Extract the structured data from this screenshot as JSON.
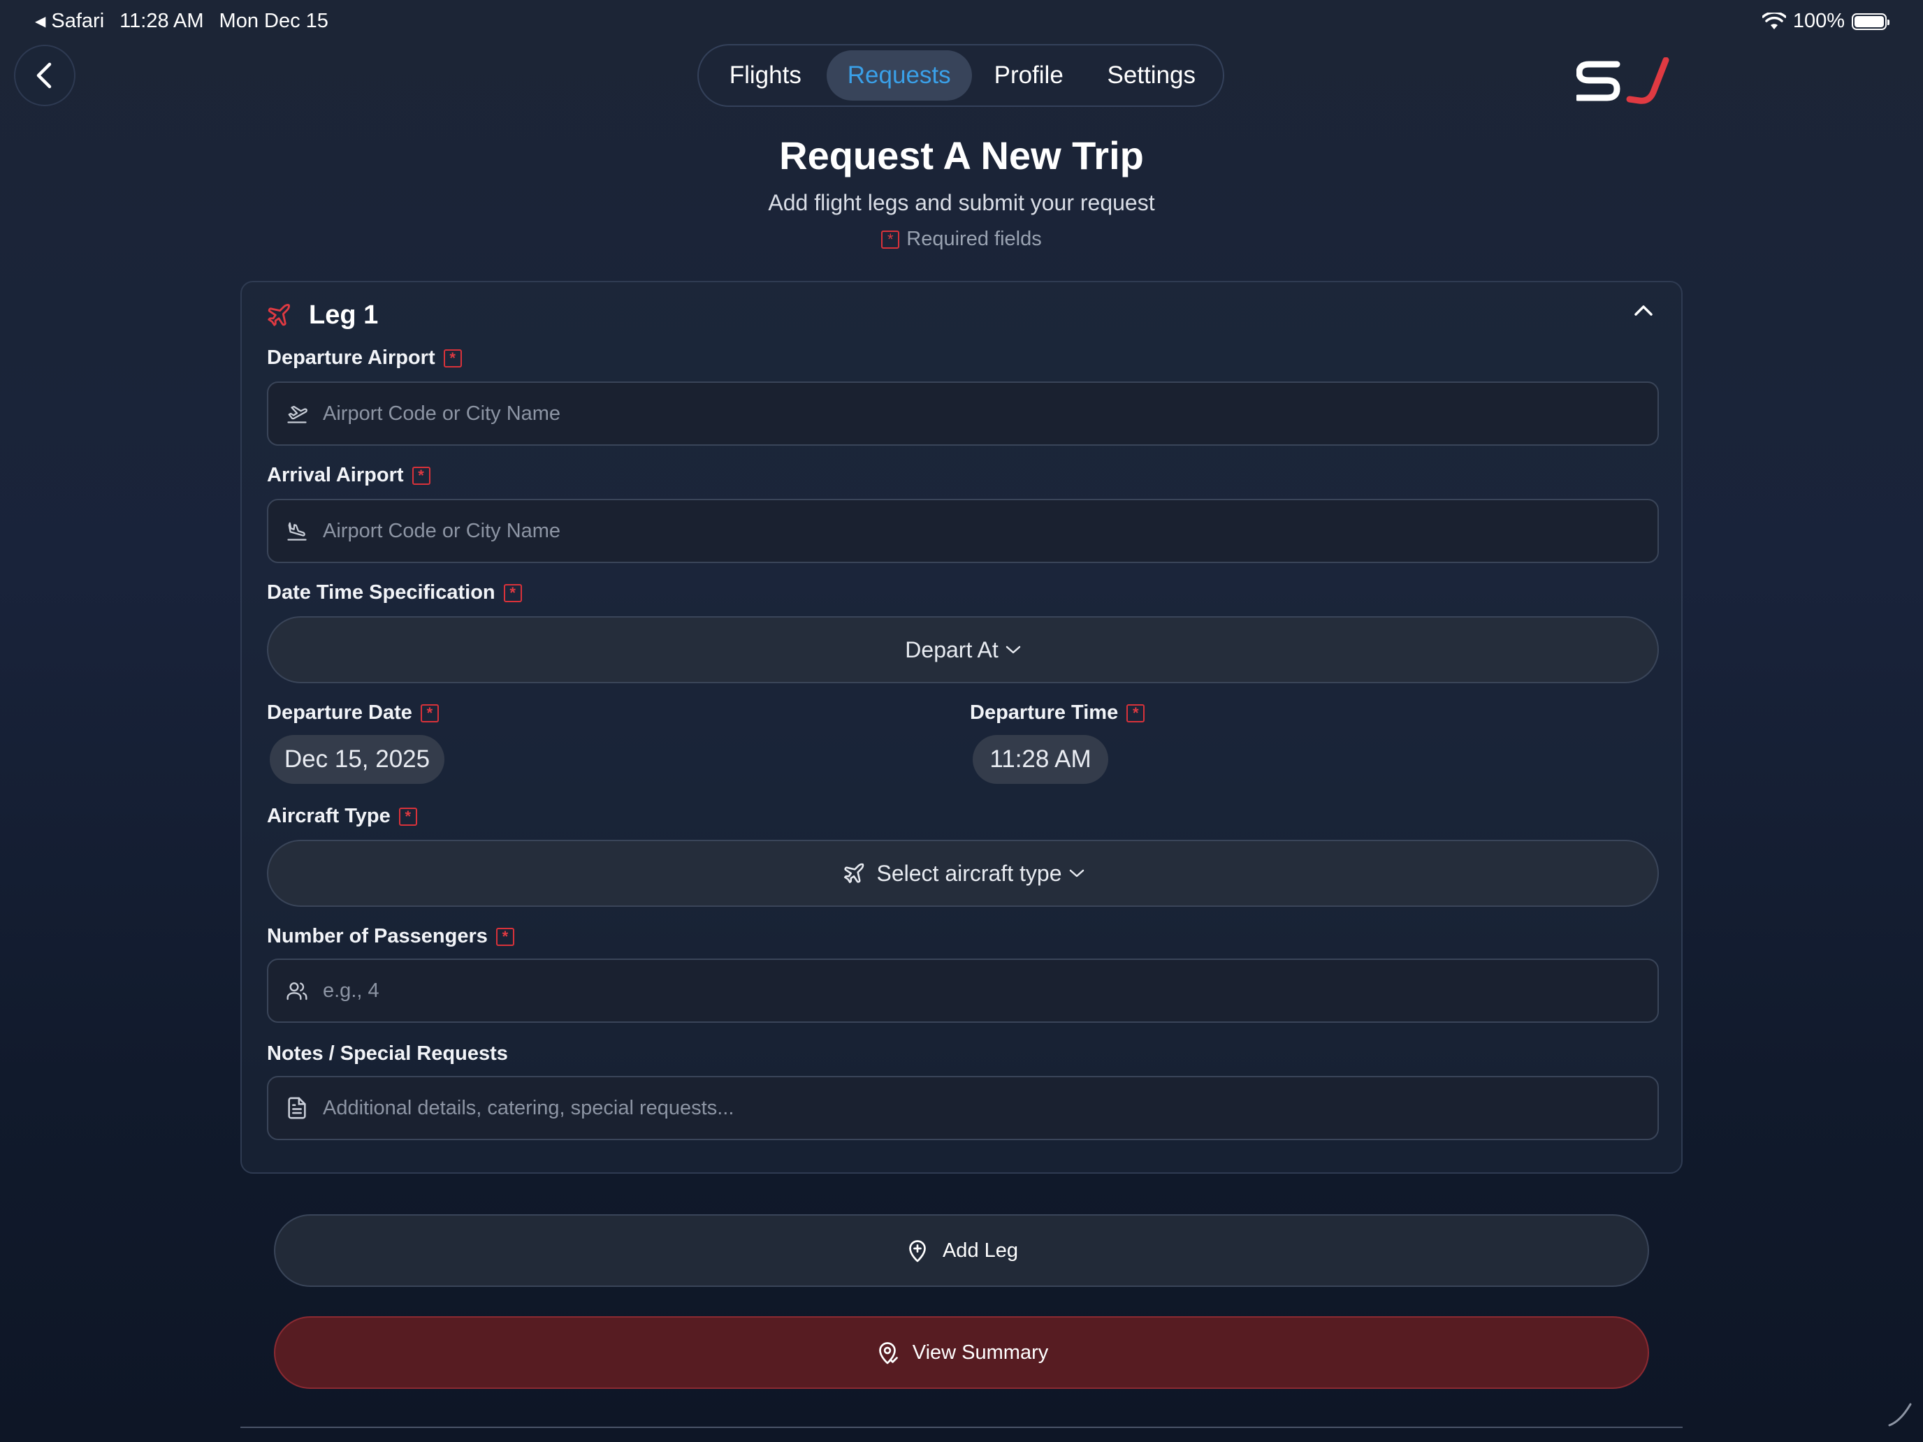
{
  "status_bar": {
    "app": "Safari",
    "time": "11:28 AM",
    "date": "Mon Dec 15",
    "battery": "100%"
  },
  "nav": {
    "tabs": [
      {
        "label": "Flights"
      },
      {
        "label": "Requests"
      },
      {
        "label": "Profile"
      },
      {
        "label": "Settings"
      }
    ],
    "active_tab": "Requests"
  },
  "header": {
    "title": "Request A New Trip",
    "subtitle": "Add flight legs and submit your request",
    "required_note": "Required fields"
  },
  "leg": {
    "title": "Leg 1",
    "departure_airport": {
      "label": "Departure Airport",
      "placeholder": "Airport Code or City Name"
    },
    "arrival_airport": {
      "label": "Arrival Airport",
      "placeholder": "Airport Code or City Name"
    },
    "date_time_spec": {
      "label": "Date Time Specification",
      "value": "Depart At"
    },
    "departure_date": {
      "label": "Departure Date",
      "value": "Dec 15, 2025"
    },
    "departure_time": {
      "label": "Departure Time",
      "value": "11:28 AM"
    },
    "aircraft_type": {
      "label": "Aircraft Type",
      "value": "Select aircraft type"
    },
    "passengers": {
      "label": "Number of Passengers",
      "placeholder": "e.g., 4"
    },
    "notes": {
      "label": "Notes / Special Requests",
      "placeholder": "Additional details, catering, special requests..."
    }
  },
  "actions": {
    "add_leg": "Add Leg",
    "view_summary": "View Summary"
  },
  "colors": {
    "accent_blue": "#3aa0e8",
    "brand_red": "#e03a42",
    "summary_bg": "#571c22"
  }
}
